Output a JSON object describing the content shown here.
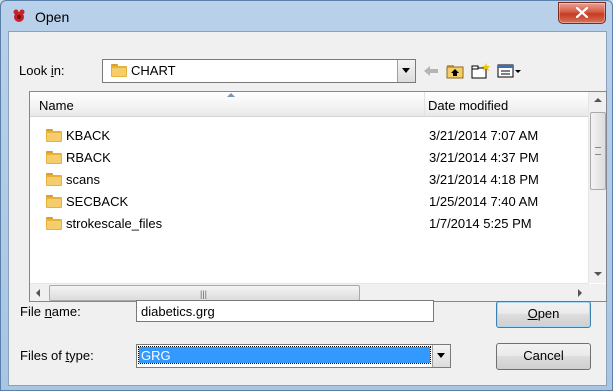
{
  "window": {
    "title": "Open"
  },
  "toolbar": {
    "lookin_label_pre": "Look ",
    "lookin_label_key": "i",
    "lookin_label_post": "n:",
    "lookin_value": "CHART"
  },
  "list": {
    "columns": {
      "name": "Name",
      "date": "Date modified"
    },
    "rows": [
      {
        "name": "KBACK",
        "date": "3/21/2014 7:07 AM"
      },
      {
        "name": "RBACK",
        "date": "3/21/2014 4:37 PM"
      },
      {
        "name": "scans",
        "date": "3/21/2014 4:18 PM"
      },
      {
        "name": "SECBACK",
        "date": "1/25/2014 7:40 AM"
      },
      {
        "name": "strokescale_files",
        "date": "1/7/2014 5:25 PM"
      }
    ]
  },
  "form": {
    "filename_label_pre": "File ",
    "filename_label_key": "n",
    "filename_label_post": "ame:",
    "filename_value": "diabetics.grg",
    "filetype_label_pre": "Files of ",
    "filetype_label_key": "t",
    "filetype_label_post": "ype:",
    "filetype_value": "GRG"
  },
  "buttons": {
    "open_key": "O",
    "open_rest": "pen",
    "cancel": "Cancel"
  },
  "colors": {
    "selection": "#3399ff",
    "folder": "#e8b23a",
    "close_button": "#c43b22"
  }
}
